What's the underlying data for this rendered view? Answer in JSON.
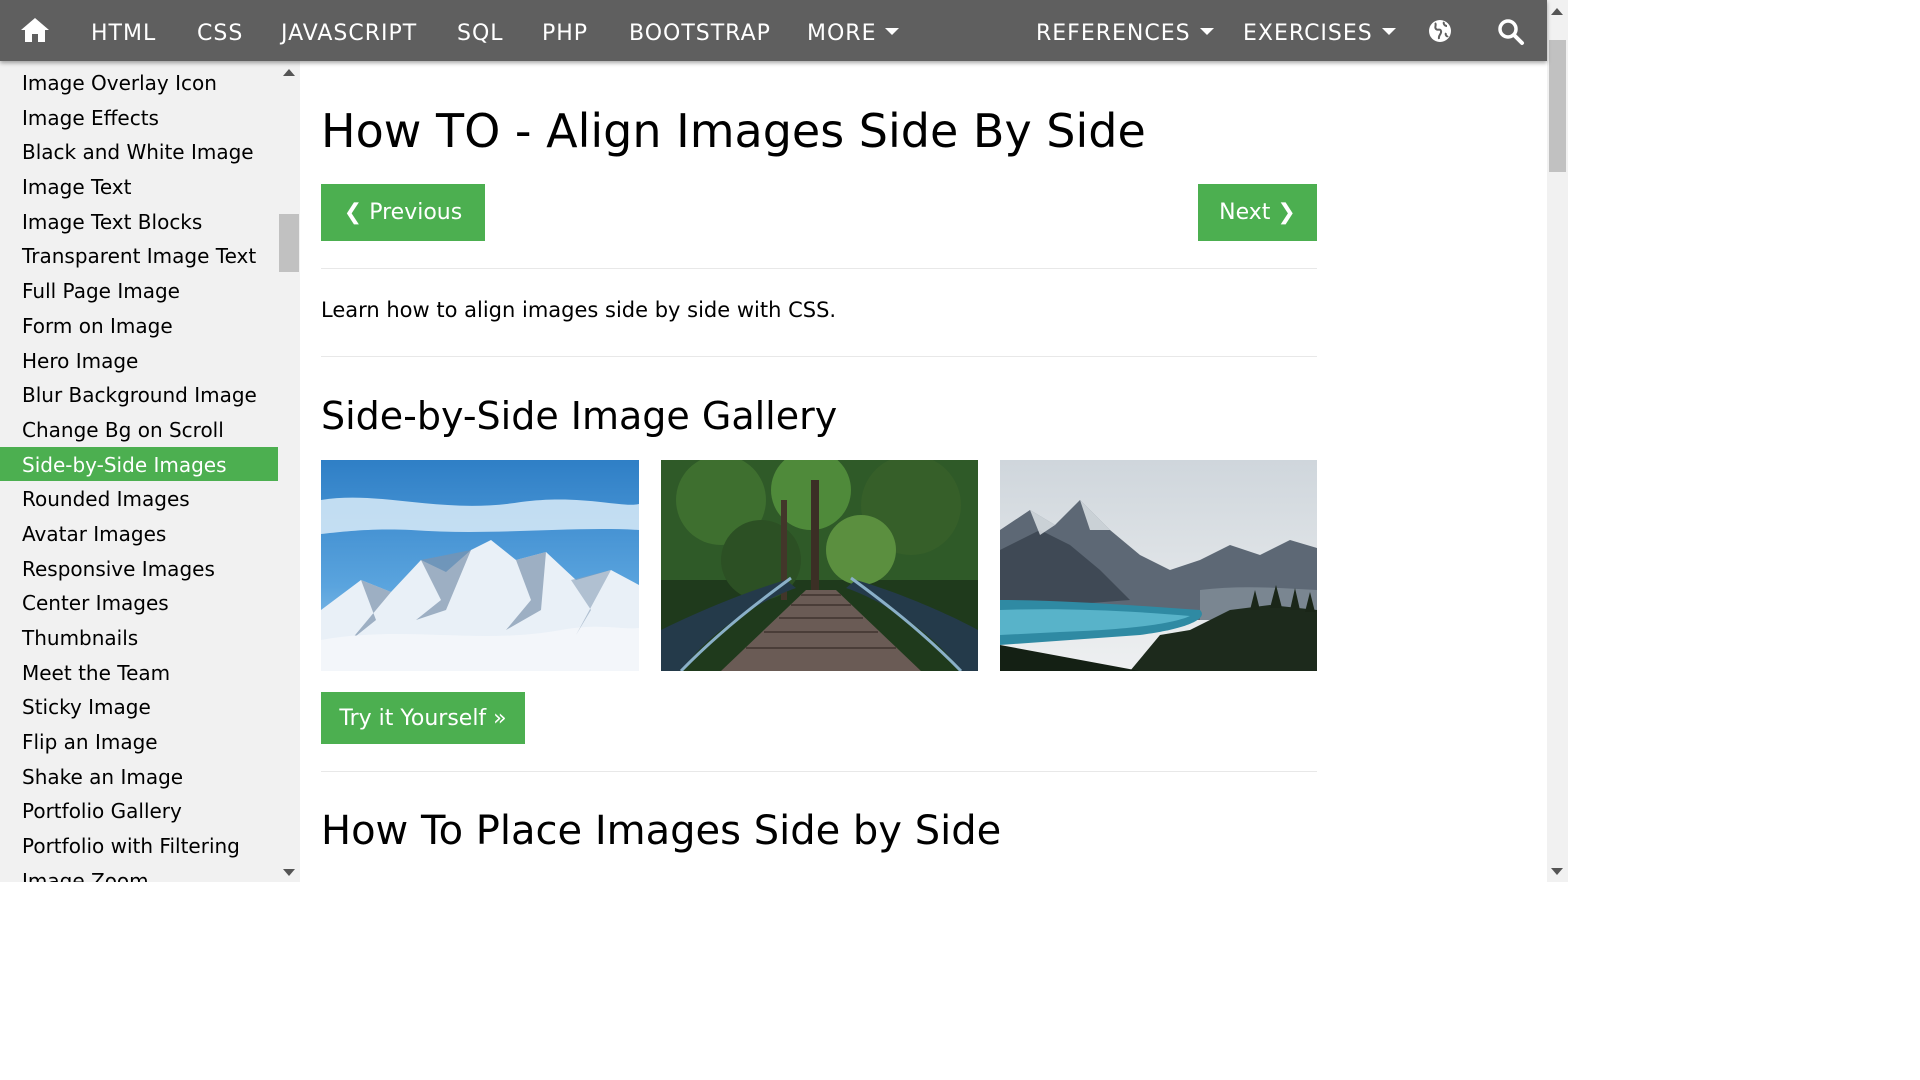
{
  "nav": {
    "home_icon": "home-icon",
    "items": [
      "HTML",
      "CSS",
      "JAVASCRIPT",
      "SQL",
      "PHP",
      "BOOTSTRAP"
    ],
    "more": "MORE",
    "references": "REFERENCES",
    "exercises": "EXERCISES",
    "globe_icon": "globe-icon",
    "search_icon": "search-icon"
  },
  "sidebar": {
    "items": [
      {
        "label": "Image Overlay Icon"
      },
      {
        "label": "Image Effects"
      },
      {
        "label": "Black and White Image"
      },
      {
        "label": "Image Text"
      },
      {
        "label": "Image Text Blocks"
      },
      {
        "label": "Transparent Image Text"
      },
      {
        "label": "Full Page Image"
      },
      {
        "label": "Form on Image"
      },
      {
        "label": "Hero Image"
      },
      {
        "label": "Blur Background Image"
      },
      {
        "label": "Change Bg on Scroll"
      },
      {
        "label": "Side-by-Side Images",
        "active": true
      },
      {
        "label": "Rounded Images"
      },
      {
        "label": "Avatar Images"
      },
      {
        "label": "Responsive Images"
      },
      {
        "label": "Center Images"
      },
      {
        "label": "Thumbnails"
      },
      {
        "label": "Meet the Team"
      },
      {
        "label": "Sticky Image"
      },
      {
        "label": "Flip an Image"
      },
      {
        "label": "Shake an Image"
      },
      {
        "label": "Portfolio Gallery"
      },
      {
        "label": "Portfolio with Filtering"
      },
      {
        "label": "Image Zoom"
      }
    ]
  },
  "main": {
    "title": "How TO - Align Images Side By Side",
    "prev_label": "❮ Previous",
    "next_label": "Next ❯",
    "intro": "Learn how to align images side by side with CSS.",
    "gallery_heading": "Side-by-Side Image Gallery",
    "images": [
      "snow-mountains-image",
      "forest-bridge-image",
      "mountain-lake-image"
    ],
    "try_label": "Try it Yourself »",
    "place_heading": "How To Place Images Side by Side"
  },
  "colors": {
    "nav_bg": "#5f5f5f",
    "accent": "#4caf50",
    "sidebar_bg": "#f1f1f1"
  }
}
